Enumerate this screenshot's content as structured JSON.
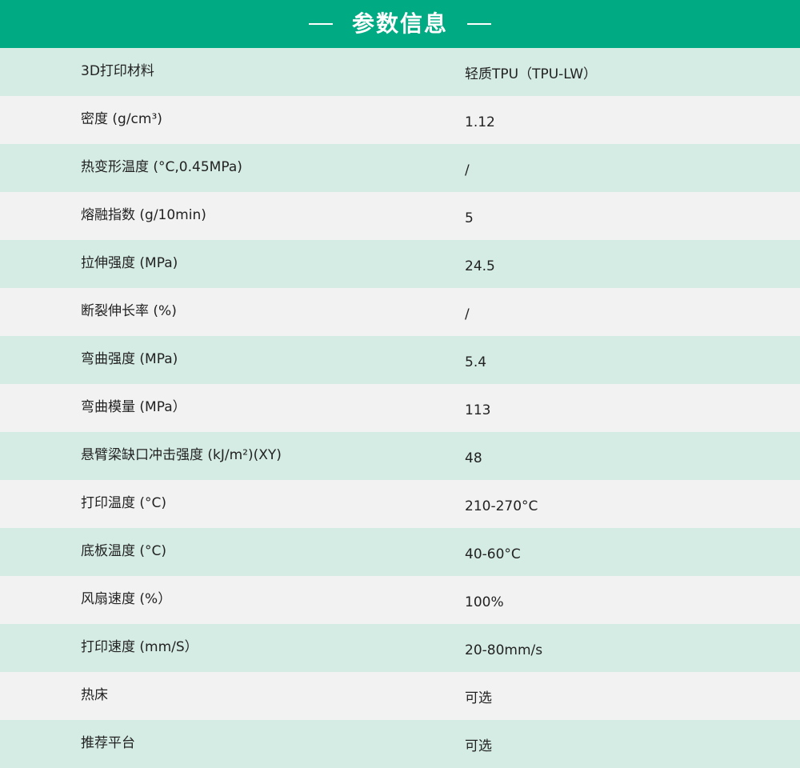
{
  "header": {
    "title": "参数信息",
    "bg_color": "#00ab84"
  },
  "colors": {
    "row_shade_a": "#d5ece5",
    "row_shade_b": "#f2f2f2",
    "text": "#222222"
  },
  "rows": [
    {
      "label": "3D打印材料",
      "value": "轻质TPU（TPU-LW）"
    },
    {
      "label": "密度 (g/cm³)",
      "value": "1.12"
    },
    {
      "label": "热变形温度 (°C,0.45MPa)",
      "value": "/"
    },
    {
      "label": "熔融指数 (g/10min)",
      "value": "5"
    },
    {
      "label": "拉伸强度 (MPa)",
      "value": "24.5"
    },
    {
      "label": "断裂伸长率 (%)",
      "value": "/"
    },
    {
      "label": "弯曲强度 (MPa)",
      "value": "5.4"
    },
    {
      "label": "弯曲模量 (MPa）",
      "value": "113"
    },
    {
      "label": "悬臂梁缺口冲击强度 (kJ/m²)(XY)",
      "value": "48"
    },
    {
      "label": "打印温度 (°C)",
      "value": "210-270°C"
    },
    {
      "label": "底板温度 (°C)",
      "value": "40-60°C"
    },
    {
      "label": "风扇速度 (%）",
      "value": "100%"
    },
    {
      "label": "打印速度 (mm/S）",
      "value": "20-80mm/s"
    },
    {
      "label": "热床",
      "value": "可选"
    },
    {
      "label": "推荐平台",
      "value": "可选"
    }
  ]
}
